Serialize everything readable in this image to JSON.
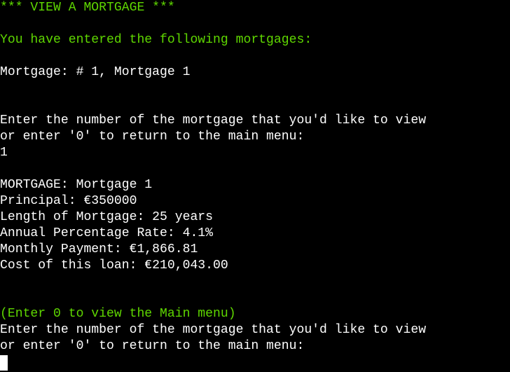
{
  "terminal": {
    "header": "*** VIEW A MORTGAGE ***",
    "intro": "You have entered the following mortgages:",
    "mortgage_list": [
      "Mortgage: # 1, Mortgage 1"
    ],
    "prompt1_line1": "Enter the number of the mortgage that you'd like to view",
    "prompt1_line2": "or enter '0' to return to the main menu:",
    "user_input": "1",
    "details": {
      "name": "MORTGAGE: Mortgage 1",
      "principal": "Principal: €350000",
      "length": "Length of Mortgage: 25 years",
      "apr": "Annual Percentage Rate: 4.1%",
      "monthly": "Monthly Payment: €1,866.81",
      "cost": "Cost of this loan: €210,043.00"
    },
    "hint": "(Enter 0 to view the Main menu)",
    "prompt2_line1": "Enter the number of the mortgage that you'd like to view",
    "prompt2_line2": "or enter '0' to return to the main menu:"
  },
  "colors": {
    "background": "#000000",
    "text": "#ffffff",
    "accent_green": "#5fd700"
  }
}
